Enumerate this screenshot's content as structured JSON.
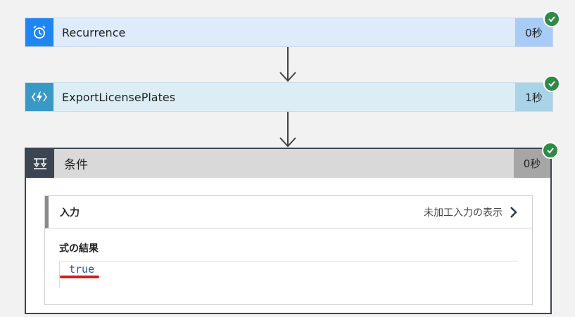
{
  "steps": [
    {
      "title": "Recurrence",
      "duration": "0秒",
      "icon": "alarm-clock-icon",
      "colors": {
        "icon_bg": "#1f85f0",
        "body_bg": "#ddebfb",
        "duration_bg": "#a8ccf5"
      },
      "status": "succeeded"
    },
    {
      "title": "ExportLicensePlates",
      "duration": "1秒",
      "icon": "function-lightning-icon",
      "colors": {
        "icon_bg": "#3999c6",
        "body_bg": "#ddedf5",
        "duration_bg": "#a9d4e8"
      },
      "status": "succeeded"
    }
  ],
  "condition": {
    "title": "条件",
    "duration": "0秒",
    "icon": "condition-icon",
    "status": "succeeded",
    "inputs_label": "入力",
    "show_raw_inputs": "未加工入力の表示",
    "result_label": "式の結果",
    "result_value": "true"
  },
  "colors": {
    "success": "#2e8a46",
    "condition_header": "#3c4652",
    "highlight_underline": "#d91c1c"
  }
}
